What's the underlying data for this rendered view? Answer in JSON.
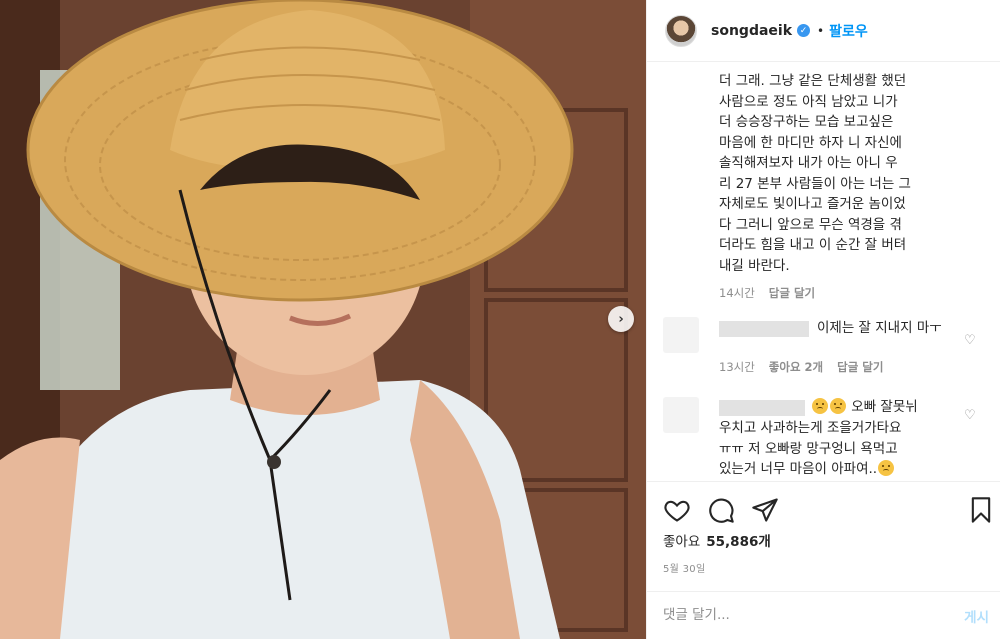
{
  "post": {
    "username": "songdaeik",
    "follow_label": "팔로우",
    "separator": "•",
    "verified_mark": "✓",
    "caption": "더 그래. 그냥 같은 단체생활 했던\n사람으로 정도 아직 남았고 니가\n더 승승장구하는 모습 보고싶은\n마음에 한 마디만 하자 니 자신에\n솔직해져보자 내가 아는 아니 우\n리 27 본부 사람들이 아는 너는 그\n자체로도 빛이나고 즐거운 놈이었\n다 그러니 앞으로 무슨 역경을 겪\n더라도 힘을 내고 이 순간 잘 버텨\n내길 바란다.",
    "caption_time": "14시간",
    "caption_reply": "답글 달기"
  },
  "comments": [
    {
      "text": "이제는 잘 지내지 마ㅜ",
      "time": "13시간",
      "likes": "좋아요 2개",
      "reply": "답글 달기"
    },
    {
      "text_line1": "오빠 잘못뉘",
      "text_rest": "우치고 사과하는게 조을거가타요\nㅠㅠ 저 오빠랑 망구엉니 욕먹고\n있는거 너무 마음이 아파여.."
    }
  ],
  "actions": {
    "likes_label": "좋아요",
    "likes_count": "55,886개",
    "date": "5월 30일",
    "comment_placeholder": "댓글 달기...",
    "post_label": "게시"
  },
  "icons": {
    "verified": "verified-badge-icon",
    "heart": "heart-icon",
    "comment": "comment-icon",
    "share": "share-icon",
    "save": "bookmark-icon",
    "next": "chevron-right-icon"
  },
  "colors": {
    "accent": "#0095f6",
    "muted": "#8e8e8e",
    "text": "#262626"
  }
}
